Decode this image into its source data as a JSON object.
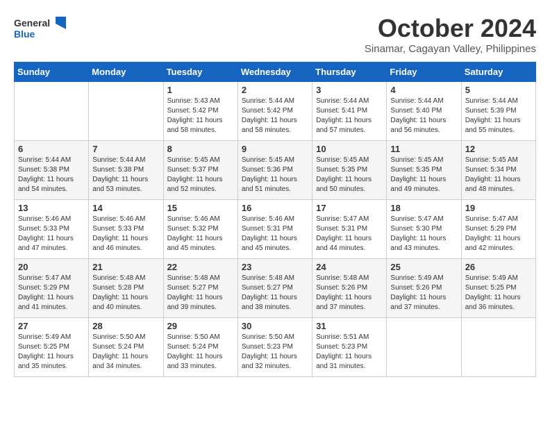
{
  "header": {
    "logo_line1": "General",
    "logo_line2": "Blue",
    "month": "October 2024",
    "location": "Sinamar, Cagayan Valley, Philippines"
  },
  "days_of_week": [
    "Sunday",
    "Monday",
    "Tuesday",
    "Wednesday",
    "Thursday",
    "Friday",
    "Saturday"
  ],
  "weeks": [
    [
      {
        "num": "",
        "sunrise": "",
        "sunset": "",
        "daylight": ""
      },
      {
        "num": "",
        "sunrise": "",
        "sunset": "",
        "daylight": ""
      },
      {
        "num": "1",
        "sunrise": "Sunrise: 5:43 AM",
        "sunset": "Sunset: 5:42 PM",
        "daylight": "Daylight: 11 hours and 58 minutes."
      },
      {
        "num": "2",
        "sunrise": "Sunrise: 5:44 AM",
        "sunset": "Sunset: 5:42 PM",
        "daylight": "Daylight: 11 hours and 58 minutes."
      },
      {
        "num": "3",
        "sunrise": "Sunrise: 5:44 AM",
        "sunset": "Sunset: 5:41 PM",
        "daylight": "Daylight: 11 hours and 57 minutes."
      },
      {
        "num": "4",
        "sunrise": "Sunrise: 5:44 AM",
        "sunset": "Sunset: 5:40 PM",
        "daylight": "Daylight: 11 hours and 56 minutes."
      },
      {
        "num": "5",
        "sunrise": "Sunrise: 5:44 AM",
        "sunset": "Sunset: 5:39 PM",
        "daylight": "Daylight: 11 hours and 55 minutes."
      }
    ],
    [
      {
        "num": "6",
        "sunrise": "Sunrise: 5:44 AM",
        "sunset": "Sunset: 5:38 PM",
        "daylight": "Daylight: 11 hours and 54 minutes."
      },
      {
        "num": "7",
        "sunrise": "Sunrise: 5:44 AM",
        "sunset": "Sunset: 5:38 PM",
        "daylight": "Daylight: 11 hours and 53 minutes."
      },
      {
        "num": "8",
        "sunrise": "Sunrise: 5:45 AM",
        "sunset": "Sunset: 5:37 PM",
        "daylight": "Daylight: 11 hours and 52 minutes."
      },
      {
        "num": "9",
        "sunrise": "Sunrise: 5:45 AM",
        "sunset": "Sunset: 5:36 PM",
        "daylight": "Daylight: 11 hours and 51 minutes."
      },
      {
        "num": "10",
        "sunrise": "Sunrise: 5:45 AM",
        "sunset": "Sunset: 5:35 PM",
        "daylight": "Daylight: 11 hours and 50 minutes."
      },
      {
        "num": "11",
        "sunrise": "Sunrise: 5:45 AM",
        "sunset": "Sunset: 5:35 PM",
        "daylight": "Daylight: 11 hours and 49 minutes."
      },
      {
        "num": "12",
        "sunrise": "Sunrise: 5:45 AM",
        "sunset": "Sunset: 5:34 PM",
        "daylight": "Daylight: 11 hours and 48 minutes."
      }
    ],
    [
      {
        "num": "13",
        "sunrise": "Sunrise: 5:46 AM",
        "sunset": "Sunset: 5:33 PM",
        "daylight": "Daylight: 11 hours and 47 minutes."
      },
      {
        "num": "14",
        "sunrise": "Sunrise: 5:46 AM",
        "sunset": "Sunset: 5:33 PM",
        "daylight": "Daylight: 11 hours and 46 minutes."
      },
      {
        "num": "15",
        "sunrise": "Sunrise: 5:46 AM",
        "sunset": "Sunset: 5:32 PM",
        "daylight": "Daylight: 11 hours and 45 minutes."
      },
      {
        "num": "16",
        "sunrise": "Sunrise: 5:46 AM",
        "sunset": "Sunset: 5:31 PM",
        "daylight": "Daylight: 11 hours and 45 minutes."
      },
      {
        "num": "17",
        "sunrise": "Sunrise: 5:47 AM",
        "sunset": "Sunset: 5:31 PM",
        "daylight": "Daylight: 11 hours and 44 minutes."
      },
      {
        "num": "18",
        "sunrise": "Sunrise: 5:47 AM",
        "sunset": "Sunset: 5:30 PM",
        "daylight": "Daylight: 11 hours and 43 minutes."
      },
      {
        "num": "19",
        "sunrise": "Sunrise: 5:47 AM",
        "sunset": "Sunset: 5:29 PM",
        "daylight": "Daylight: 11 hours and 42 minutes."
      }
    ],
    [
      {
        "num": "20",
        "sunrise": "Sunrise: 5:47 AM",
        "sunset": "Sunset: 5:29 PM",
        "daylight": "Daylight: 11 hours and 41 minutes."
      },
      {
        "num": "21",
        "sunrise": "Sunrise: 5:48 AM",
        "sunset": "Sunset: 5:28 PM",
        "daylight": "Daylight: 11 hours and 40 minutes."
      },
      {
        "num": "22",
        "sunrise": "Sunrise: 5:48 AM",
        "sunset": "Sunset: 5:27 PM",
        "daylight": "Daylight: 11 hours and 39 minutes."
      },
      {
        "num": "23",
        "sunrise": "Sunrise: 5:48 AM",
        "sunset": "Sunset: 5:27 PM",
        "daylight": "Daylight: 11 hours and 38 minutes."
      },
      {
        "num": "24",
        "sunrise": "Sunrise: 5:48 AM",
        "sunset": "Sunset: 5:26 PM",
        "daylight": "Daylight: 11 hours and 37 minutes."
      },
      {
        "num": "25",
        "sunrise": "Sunrise: 5:49 AM",
        "sunset": "Sunset: 5:26 PM",
        "daylight": "Daylight: 11 hours and 37 minutes."
      },
      {
        "num": "26",
        "sunrise": "Sunrise: 5:49 AM",
        "sunset": "Sunset: 5:25 PM",
        "daylight": "Daylight: 11 hours and 36 minutes."
      }
    ],
    [
      {
        "num": "27",
        "sunrise": "Sunrise: 5:49 AM",
        "sunset": "Sunset: 5:25 PM",
        "daylight": "Daylight: 11 hours and 35 minutes."
      },
      {
        "num": "28",
        "sunrise": "Sunrise: 5:50 AM",
        "sunset": "Sunset: 5:24 PM",
        "daylight": "Daylight: 11 hours and 34 minutes."
      },
      {
        "num": "29",
        "sunrise": "Sunrise: 5:50 AM",
        "sunset": "Sunset: 5:24 PM",
        "daylight": "Daylight: 11 hours and 33 minutes."
      },
      {
        "num": "30",
        "sunrise": "Sunrise: 5:50 AM",
        "sunset": "Sunset: 5:23 PM",
        "daylight": "Daylight: 11 hours and 32 minutes."
      },
      {
        "num": "31",
        "sunrise": "Sunrise: 5:51 AM",
        "sunset": "Sunset: 5:23 PM",
        "daylight": "Daylight: 11 hours and 31 minutes."
      },
      {
        "num": "",
        "sunrise": "",
        "sunset": "",
        "daylight": ""
      },
      {
        "num": "",
        "sunrise": "",
        "sunset": "",
        "daylight": ""
      }
    ]
  ]
}
